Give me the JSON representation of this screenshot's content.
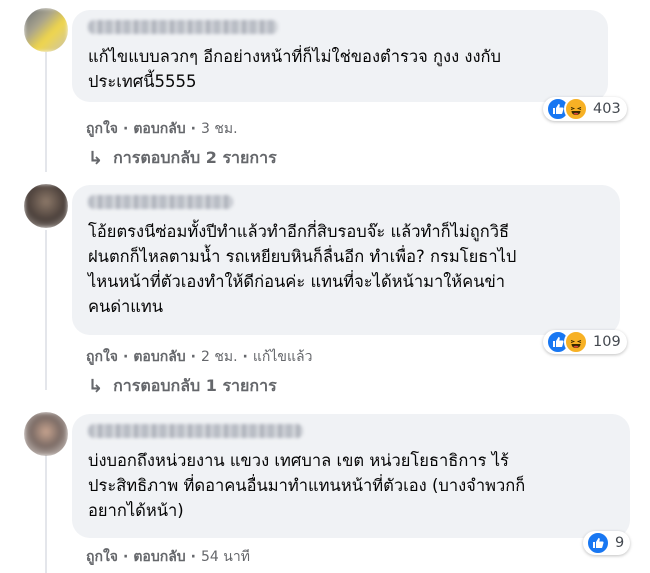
{
  "comments": [
    {
      "text": "แก้ไขแบบลวกๆ อีกอย่างหน้าที่ก็ไม่ใช่ของตำรวจ กูงง งงกับ\nประเทศนี้5555",
      "reaction_count": "403",
      "reactions": [
        "like-icon",
        "haha-icon"
      ],
      "like_label": "ถูกใจ",
      "reply_label": "ตอบกลับ",
      "time": "3 ชม.",
      "edited": "",
      "replies_label": "การตอบกลับ 2 รายการ"
    },
    {
      "text": "โอ้ยตรงนีซ่อมทั้งปีทำแล้วทำอีกกี่สิบรอบจ๊ะ แล้วทำก็ไม่ถูกวิธี\nฝนตกก็ไหลตามน้ำ รถเหยียบหินก็ลื่นอีก ทำเพื่อ? กรมโยธาไป\nไหนหน้าที่ตัวเองทำให้ดีก่อนค่ะ แทนที่จะได้หน้ามาให้คนข่า\nคนด่าแทน",
      "reaction_count": "109",
      "reactions": [
        "like-icon",
        "haha-icon"
      ],
      "like_label": "ถูกใจ",
      "reply_label": "ตอบกลับ",
      "time": "2 ชม.",
      "edited": "แก้ไขแล้ว",
      "replies_label": "การตอบกลับ 1 รายการ"
    },
    {
      "text": "บ่งบอกถึงหน่วยงาน แขวง เทศบาล เขต หน่วยโยธาธิการ ไร้\nประสิทธิภาพ ที่ดอาคนอื่นมาทำแทนหน้าที่ตัวเอง (บางจำพวกก็\nอยากได้หน้า)",
      "reaction_count": "9",
      "reactions": [
        "like-icon"
      ],
      "like_label": "ถูกใจ",
      "reply_label": "ตอบกลับ",
      "time": "54 นาที",
      "edited": "",
      "replies_label": ""
    }
  ],
  "colors": {
    "bubble": "#f0f2f5",
    "meta_text": "#65676b",
    "like_blue": "#1877f2",
    "haha_yellow": "#f7b125"
  }
}
